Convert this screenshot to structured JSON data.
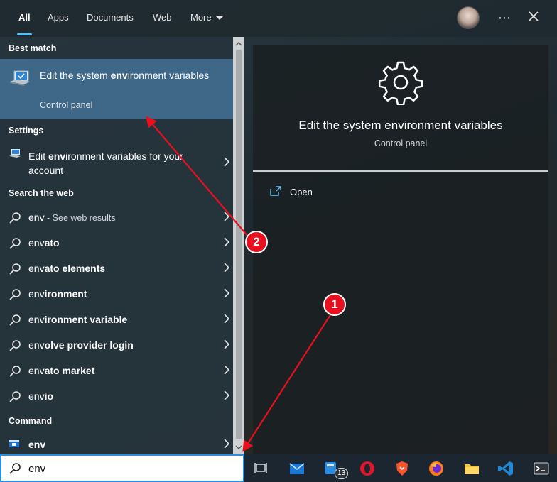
{
  "tabs": [
    {
      "label": "All",
      "active": true
    },
    {
      "label": "Apps"
    },
    {
      "label": "Documents"
    },
    {
      "label": "Web"
    },
    {
      "label": "More"
    }
  ],
  "best_match": {
    "section": "Best match",
    "title_pre": "Edit the system ",
    "title_bold": "env",
    "title_post": "ironment variables",
    "subtitle": "Control panel"
  },
  "settings": {
    "section": "Settings",
    "item_pre": "Edit ",
    "item_bold": "env",
    "item_post": "ironment variables for your account"
  },
  "web": {
    "section": "Search the web",
    "items": [
      {
        "bold": "env",
        "rest": "",
        "muted": " - See web results"
      },
      {
        "bold": "env",
        "rest": "ato"
      },
      {
        "bold": "env",
        "rest": "ato elements"
      },
      {
        "bold": "env",
        "rest": "ironment"
      },
      {
        "bold": "env",
        "rest": "ironment variable"
      },
      {
        "bold": "env",
        "rest": "olve provider login"
      },
      {
        "bold": "env",
        "rest": "ato market"
      },
      {
        "bold": "env",
        "rest": "io"
      }
    ]
  },
  "command": {
    "section": "Command",
    "item": "env"
  },
  "preview": {
    "title": "Edit the system environment variables",
    "subtitle": "Control panel",
    "action_open": "Open"
  },
  "search": {
    "value": "env"
  },
  "taskbar": {
    "mail_badge": "13"
  },
  "annotations": [
    {
      "label": "1"
    },
    {
      "label": "2"
    }
  ],
  "colors": {
    "accent": "#4cc2ff",
    "selected": "#3e6788",
    "annotation": "#e8101e"
  }
}
